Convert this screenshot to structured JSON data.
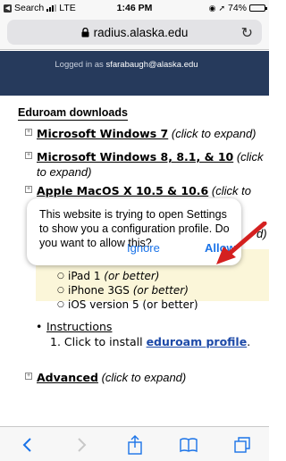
{
  "status_bar": {
    "back_app": "Search",
    "carrier": "LTE",
    "time": "1:46 PM",
    "battery": "74%",
    "battery_level": 0.74
  },
  "browser": {
    "url": "radius.alaska.edu"
  },
  "page": {
    "logged_in_prefix": "Logged in as",
    "username": "sfarabaugh@alaska.edu",
    "section_title": "Eduroam downloads",
    "items": [
      {
        "os": "Microsoft Windows 7",
        "hint": "(click to expand)"
      },
      {
        "os": "Microsoft Windows 8, 8.1, & 10",
        "hint": "(click to expand)"
      },
      {
        "os": "Apple MacOS X 10.5 & 10.6",
        "hint": "(click to"
      },
      {
        "os": "Advanced",
        "hint": "(click to expand)"
      }
    ],
    "requirements": [
      {
        "device": "iPad 1",
        "note": "(or better)"
      },
      {
        "device": "iPhone 3GS",
        "note": "(or better)"
      },
      {
        "device": "iOS version 5 (or better)",
        "note": ""
      }
    ],
    "instructions_label": "Instructions",
    "step_prefix": "1. Click to install ",
    "profile_link": "eduroam profile",
    "step_suffix": ".",
    "partial_right": "d)"
  },
  "dialog": {
    "message": "This website is trying to open Settings to show you a configuration profile. Do you want to allow this?",
    "ignore_label": "Ignore",
    "allow_label": "Allow"
  },
  "colors": {
    "header": "#263a5c",
    "link": "#1d4aa8",
    "dialog_button": "#1a73e8",
    "annotation_arrow": "#d42020",
    "highlight": "#fbf6d9"
  },
  "toolbar": {
    "icons": [
      "back-icon",
      "forward-icon",
      "share-icon",
      "bookmarks-icon",
      "tabs-icon"
    ]
  }
}
